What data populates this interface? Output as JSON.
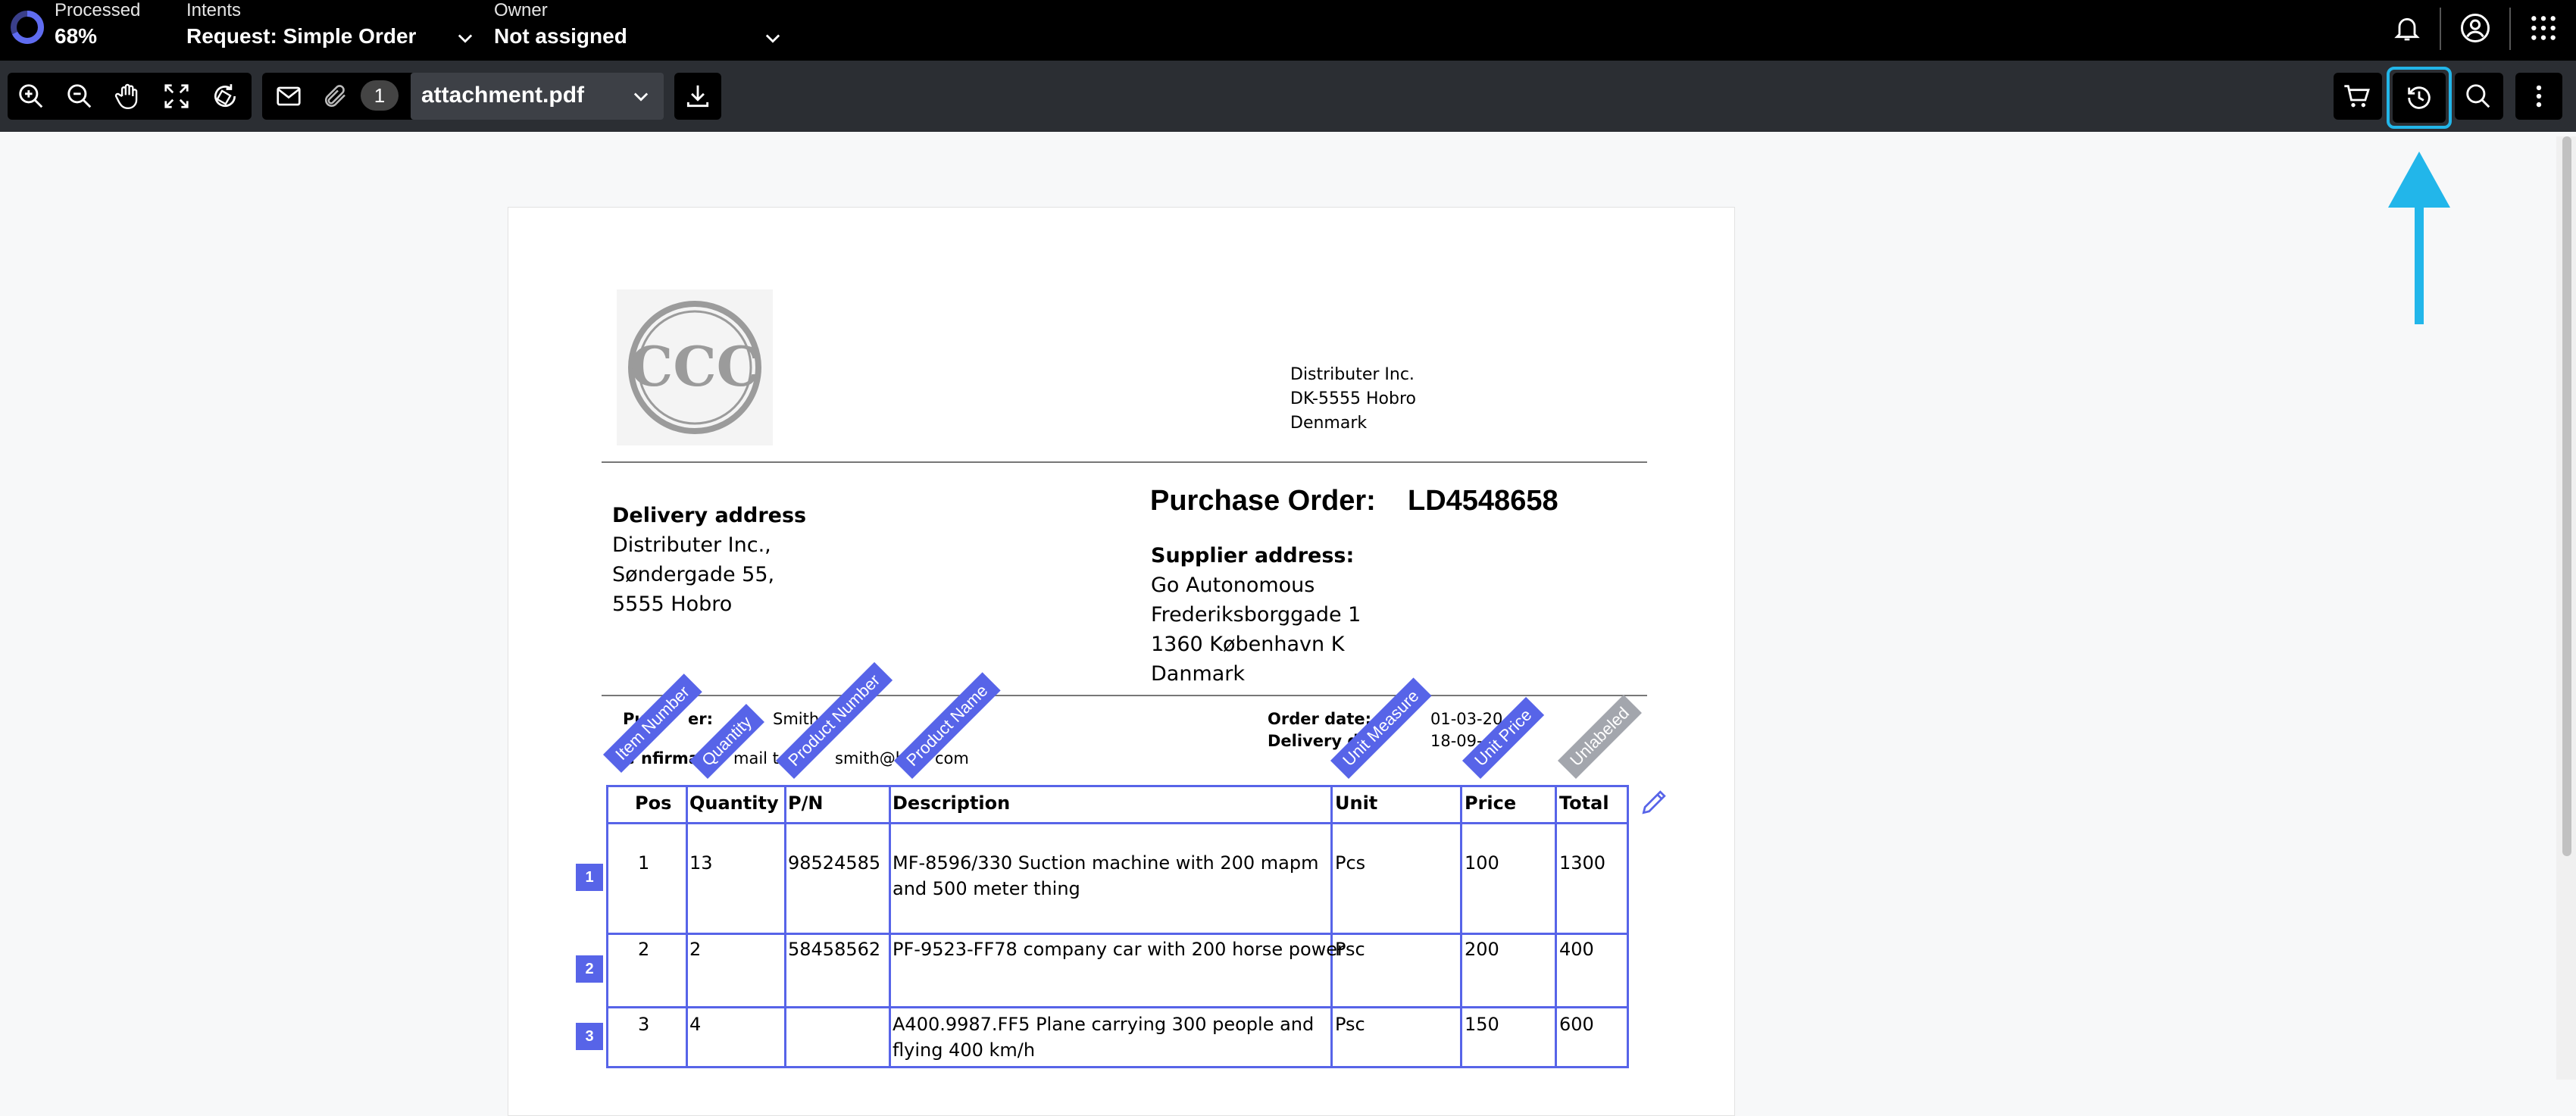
{
  "header": {
    "processed_label": "Processed",
    "processed_value": "68%",
    "processed_fraction": 0.68,
    "intents_label": "Intents",
    "intents_value": "Request: Simple Order",
    "owner_label": "Owner",
    "owner_value": "Not assigned",
    "icons": [
      "progress-ring-icon",
      "bell-icon",
      "user-circle-icon",
      "app-grid-icon"
    ]
  },
  "toolbar": {
    "tools": [
      "zoom-in-icon",
      "zoom-out-icon",
      "hand-pan-icon",
      "fit-page-icon",
      "rotate-icon"
    ],
    "page_count": "1",
    "file_name": "attachment.pdf",
    "right_tools": [
      "cart-icon",
      "history-icon",
      "search-icon",
      "more-vertical-icon"
    ],
    "active_tool": "history-icon",
    "accent_color": "#22b6ea"
  },
  "document": {
    "logo_text": "CCC",
    "sender": [
      "Distributer Inc.",
      "DK-5555 Hobro",
      "Denmark"
    ],
    "po_title": "Purchase Order:",
    "po_number": "LD4548658",
    "delivery_heading": "Delivery address",
    "delivery_lines": [
      "Distributer Inc.,",
      "Søndergade 55,",
      "5555 Hobro"
    ],
    "supplier_heading": "Supplier address:",
    "supplier_lines": [
      "Go Autonomous",
      "Frederiksborggade 1",
      "1360 København K",
      "Danmark"
    ],
    "purchaser_label": "Pur",
    "purchaser_label_end": "er:",
    "purchaser_value": "Smith",
    "confirmation_start": "C",
    "confirmation_label": "nfirma",
    "confirmation_mid": "mail to b",
    "confirmation_end": "smith@b",
    "confirmation_tail": "com",
    "order_date_label": "Order date:",
    "order_date_value": "01-03-20",
    "delivery_date_label": "Delivery d",
    "delivery_date_value": "18-09-",
    "table": {
      "headers": [
        "Pos",
        "Quantity",
        "P/N",
        "Description",
        "Unit",
        "Price",
        "Total"
      ],
      "rows": [
        {
          "pos": "1",
          "qty": "13",
          "pn": "98524585",
          "desc1": "MF-8596/330 Suction machine with 200 mapm",
          "desc2": "and 500 meter thing",
          "unit": "Pcs",
          "price": "100",
          "total": "1300"
        },
        {
          "pos": "2",
          "qty": "2",
          "pn": "58458562",
          "desc1": "PF-9523-FF78 company car with 200 horse power",
          "desc2": "",
          "unit": "Psc",
          "price": "200",
          "total": "400"
        },
        {
          "pos": "3",
          "qty": "4",
          "pn": "",
          "desc1": "A400.9987.FF5 Plane carrying 300 people and",
          "desc2": "flying 400 km/h",
          "unit": "Psc",
          "price": "150",
          "total": "600"
        }
      ]
    },
    "column_tags": [
      "Item Number",
      "Quantity",
      "Product Number",
      "Product Name",
      "Unit Measure",
      "Unit Price",
      "Unlabeled"
    ],
    "row_badges": [
      "1",
      "2",
      "3"
    ],
    "annotation_color": "#5764e8",
    "unlabeled_color": "#a3a6ad"
  }
}
